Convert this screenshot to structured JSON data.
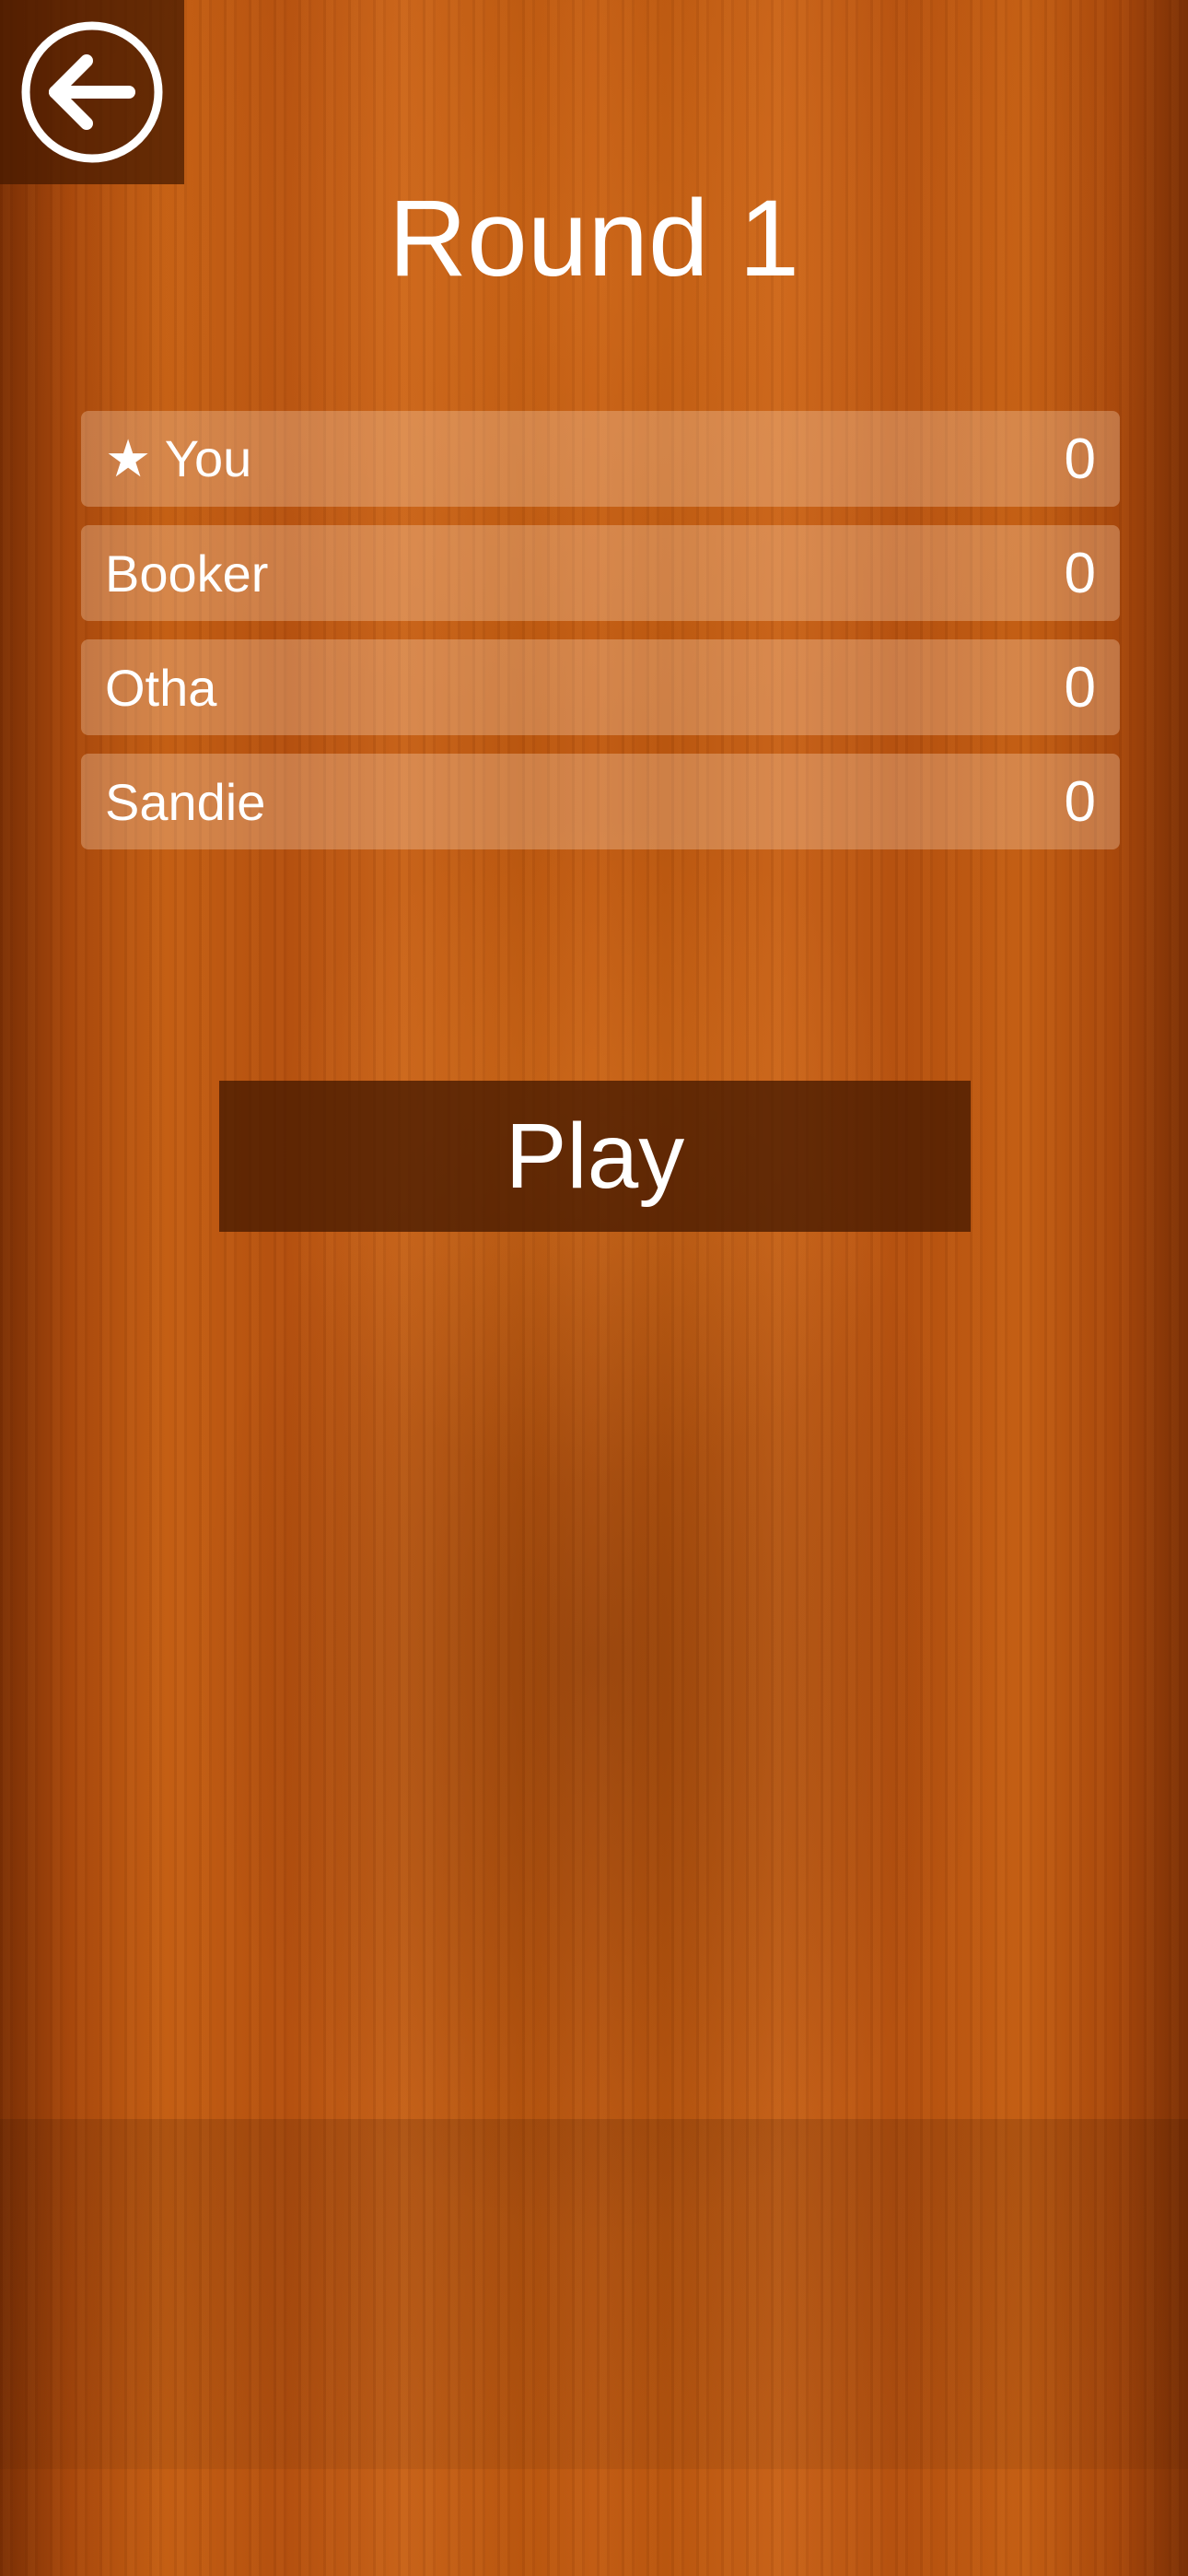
{
  "title": "Round 1",
  "back_icon": "arrow-left-circle-icon",
  "players": [
    {
      "name": "★ You",
      "score": "0"
    },
    {
      "name": "Booker",
      "score": "0"
    },
    {
      "name": "Otha",
      "score": "0"
    },
    {
      "name": "Sandie",
      "score": "0"
    }
  ],
  "play_label": "Play",
  "colors": {
    "background": "#b8560e",
    "panel_dark": "#461900",
    "text": "#ffffff"
  }
}
